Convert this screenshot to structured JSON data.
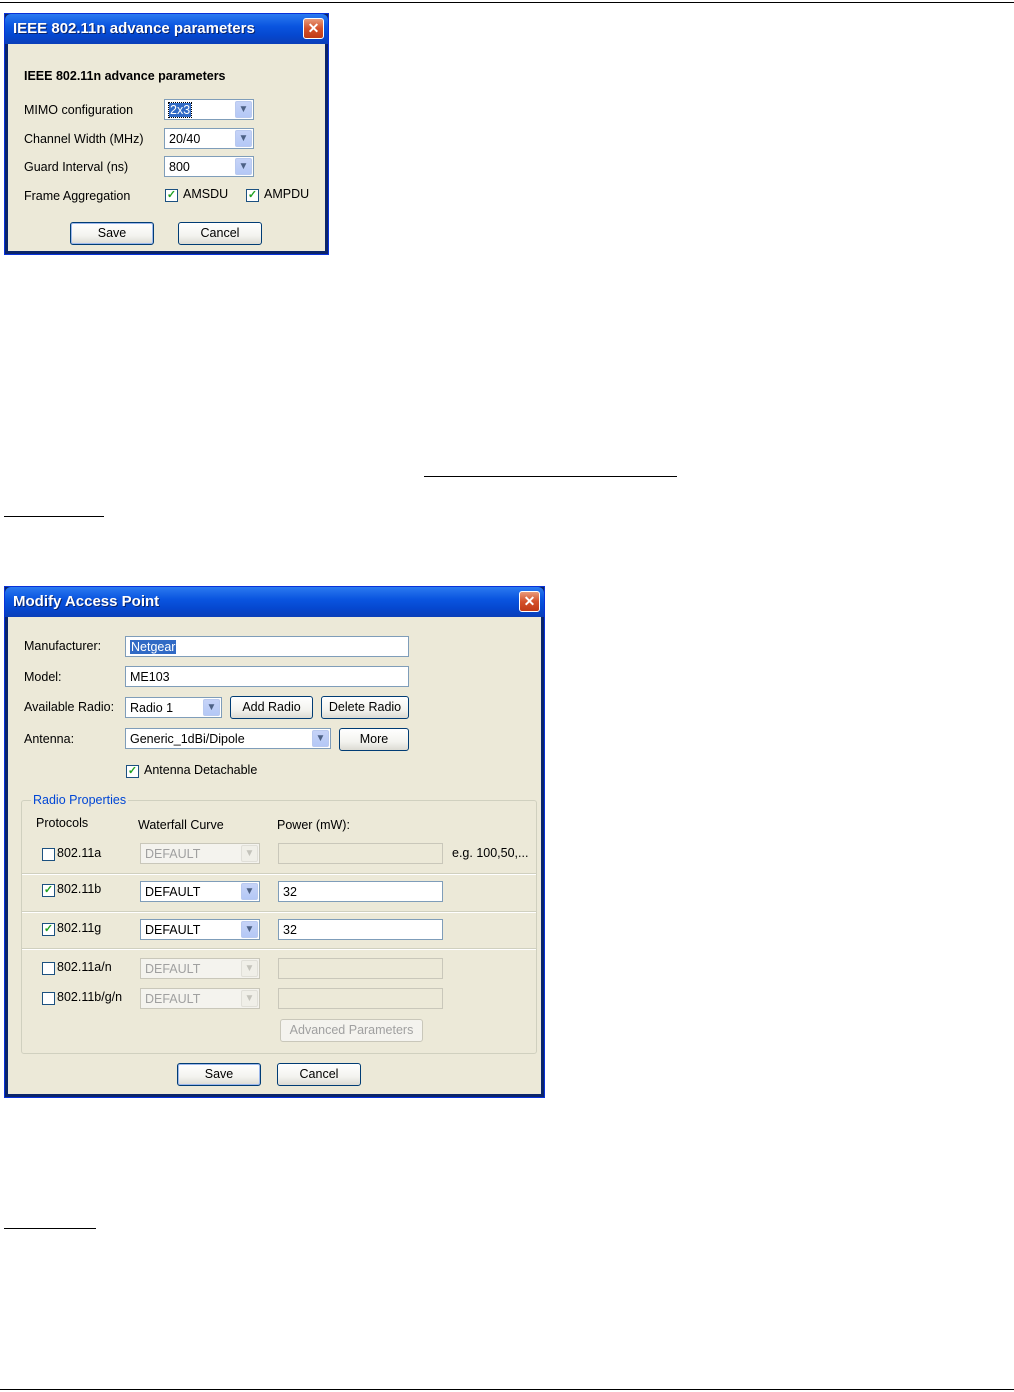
{
  "dialog1": {
    "title": "IEEE 802.11n advance parameters",
    "heading": "IEEE 802.11n advance parameters",
    "mimo_label": "MIMO configuration",
    "mimo_value": "2x3",
    "channel_width_label": "Channel Width (MHz)",
    "channel_width_value": "20/40",
    "guard_interval_label": "Guard Interval (ns)",
    "guard_interval_value": "800",
    "frame_aggregation_label": "Frame Aggregation",
    "amsdu_label": "AMSDU",
    "amsdu_checked": true,
    "ampdu_label": "AMPDU",
    "ampdu_checked": true,
    "save_label": "Save",
    "cancel_label": "Cancel",
    "close_glyph": "✕"
  },
  "dialog2": {
    "title": "Modify Access Point",
    "close_glyph": "✕",
    "manufacturer_label": "Manufacturer:",
    "manufacturer_value": "Netgear",
    "model_label": "Model:",
    "model_value": "ME103",
    "available_radio_label": "Available Radio:",
    "available_radio_value": "Radio 1",
    "add_radio_label": "Add Radio",
    "delete_radio_label": "Delete Radio",
    "antenna_label": "Antenna:",
    "antenna_value": "Generic_1dBi/Dipole",
    "more_label": "More",
    "antenna_detachable_label": "Antenna Detachable",
    "antenna_detachable_checked": true,
    "radio_properties_label": "Radio Properties",
    "col_protocols": "Protocols",
    "col_waterfall": "Waterfall Curve",
    "col_power": "Power (mW):",
    "example_hint": "e.g. 100,50,...",
    "rows": [
      {
        "protocol": "802.11a",
        "checked": false,
        "curve": "DEFAULT",
        "power": "",
        "enabled": false
      },
      {
        "protocol": "802.11b",
        "checked": true,
        "curve": "DEFAULT",
        "power": "32",
        "enabled": true
      },
      {
        "protocol": "802.11g",
        "checked": true,
        "curve": "DEFAULT",
        "power": "32",
        "enabled": true
      },
      {
        "protocol": "802.11a/n",
        "checked": false,
        "curve": "DEFAULT",
        "power": "",
        "enabled": false
      },
      {
        "protocol": "802.11b/g/n",
        "checked": false,
        "curve": "DEFAULT",
        "power": "",
        "enabled": false
      }
    ],
    "advanced_parameters_label": "Advanced Parameters",
    "save_label": "Save",
    "cancel_label": "Cancel"
  },
  "colors": {
    "dialog_bg": "#ece9d8",
    "titlebar": "#0a55e0",
    "close_button": "#d4512b",
    "selection": "#316ac5",
    "group_legend": "#0046d5",
    "check_mark": "#21a121"
  }
}
